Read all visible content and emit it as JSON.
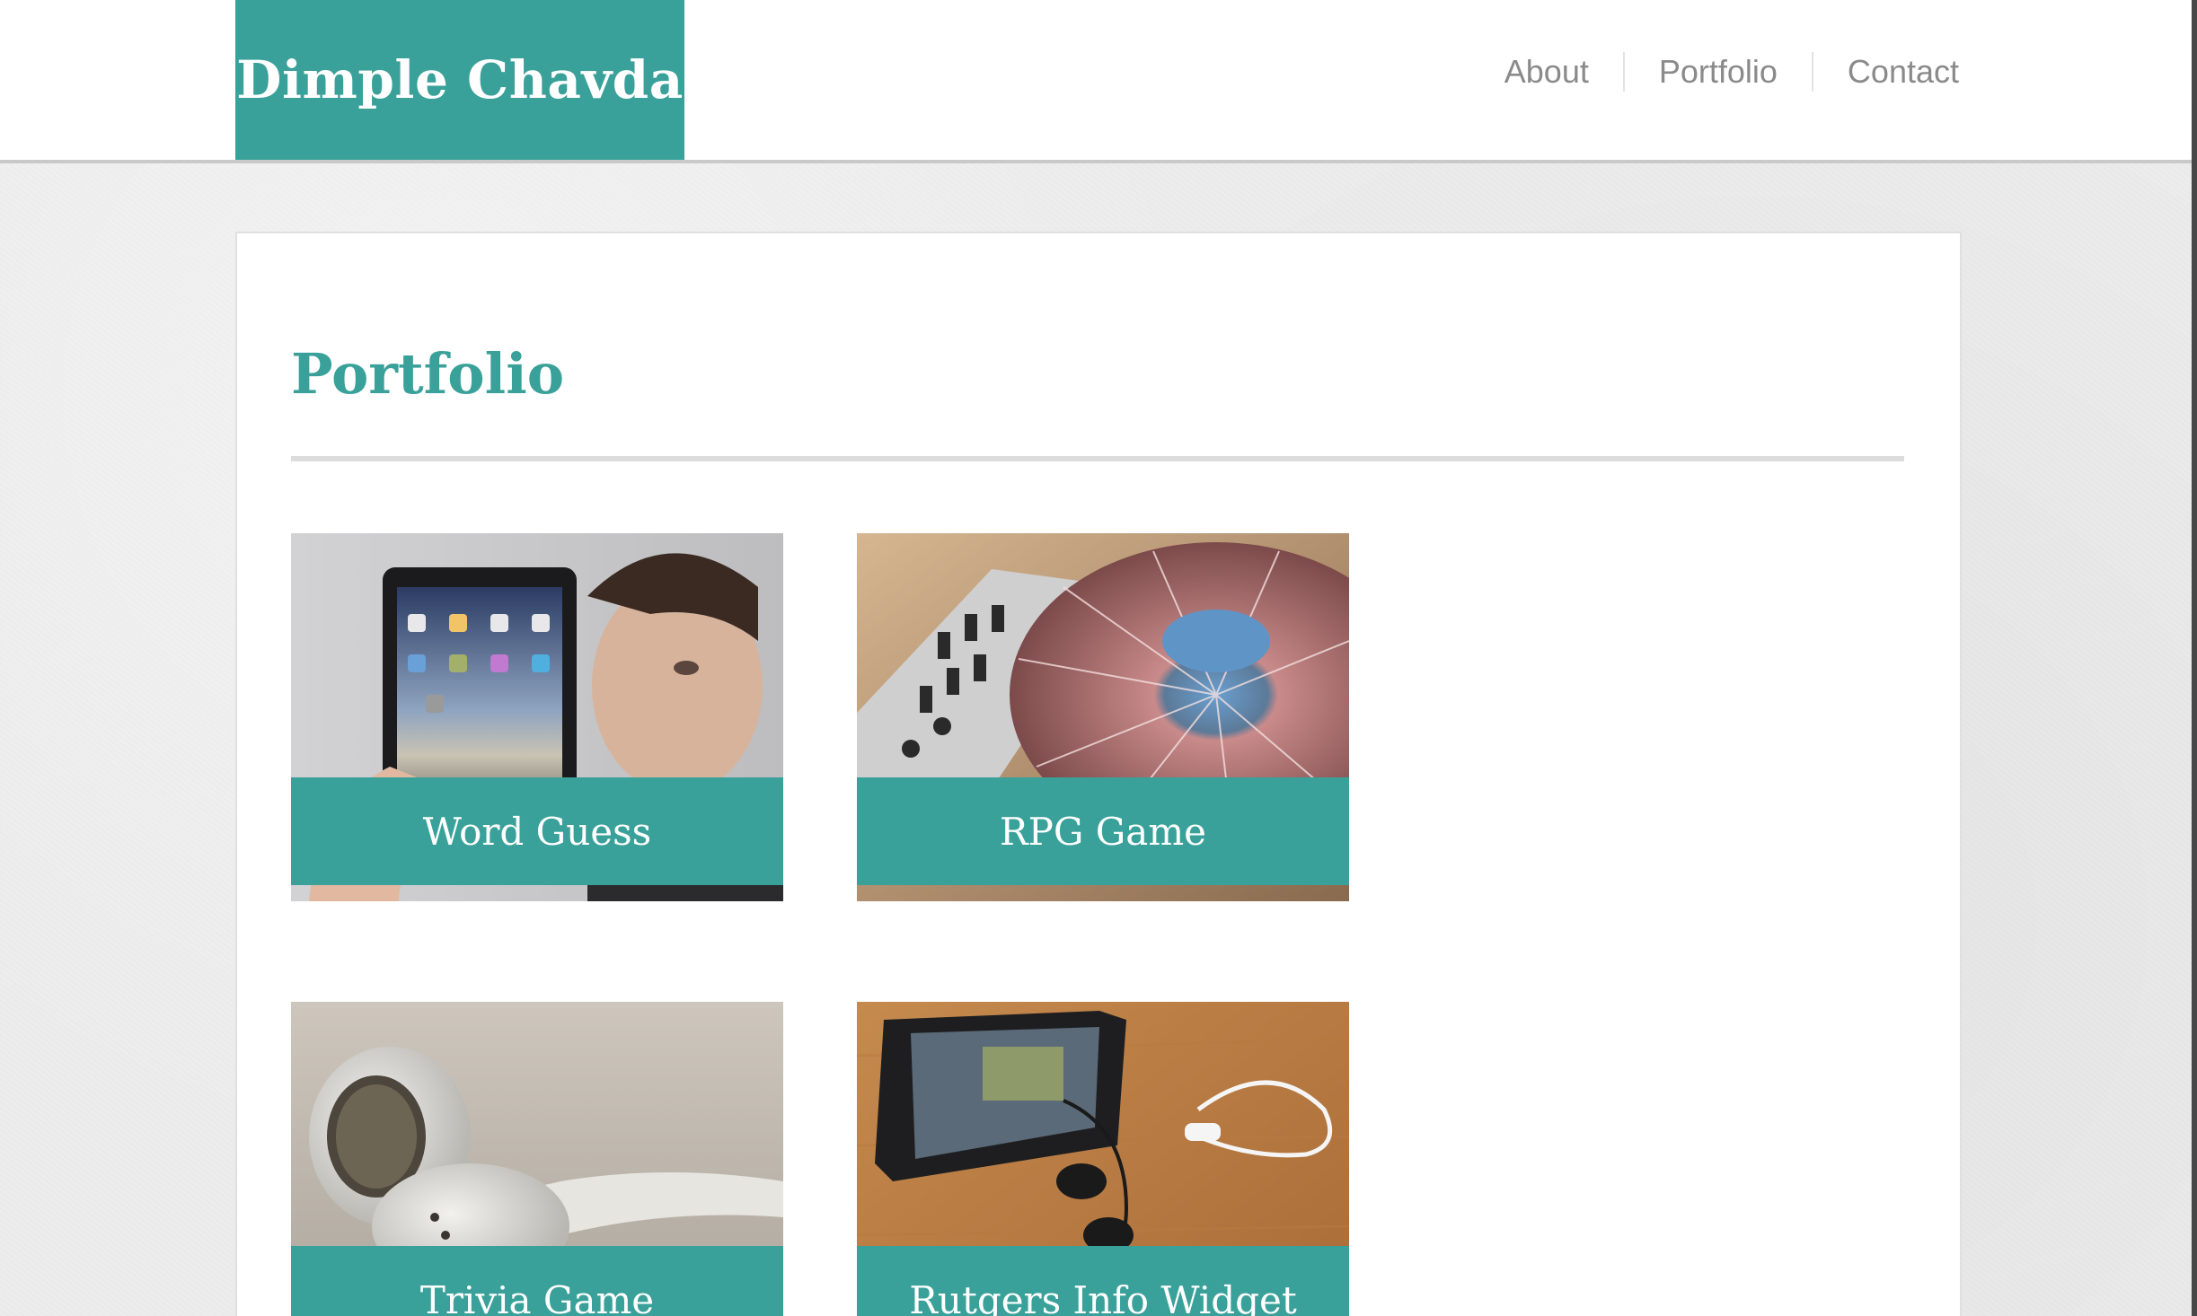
{
  "header": {
    "brand": "Dimple Chavda",
    "nav": [
      "About",
      "Portfolio",
      "Contact"
    ]
  },
  "main": {
    "title": "Portfolio",
    "projects": [
      {
        "label": "Word Guess",
        "image": "person-holding-tablet"
      },
      {
        "label": "RPG Game",
        "image": "dj-turntable"
      },
      {
        "label": "Trivia Game",
        "image": "earbuds"
      },
      {
        "label": "Rutgers Info Widget",
        "image": "phone-with-earphones"
      }
    ]
  },
  "colors": {
    "accent": "#3aa19a",
    "nav_text": "#8a8a8a",
    "background": "#ececec"
  }
}
